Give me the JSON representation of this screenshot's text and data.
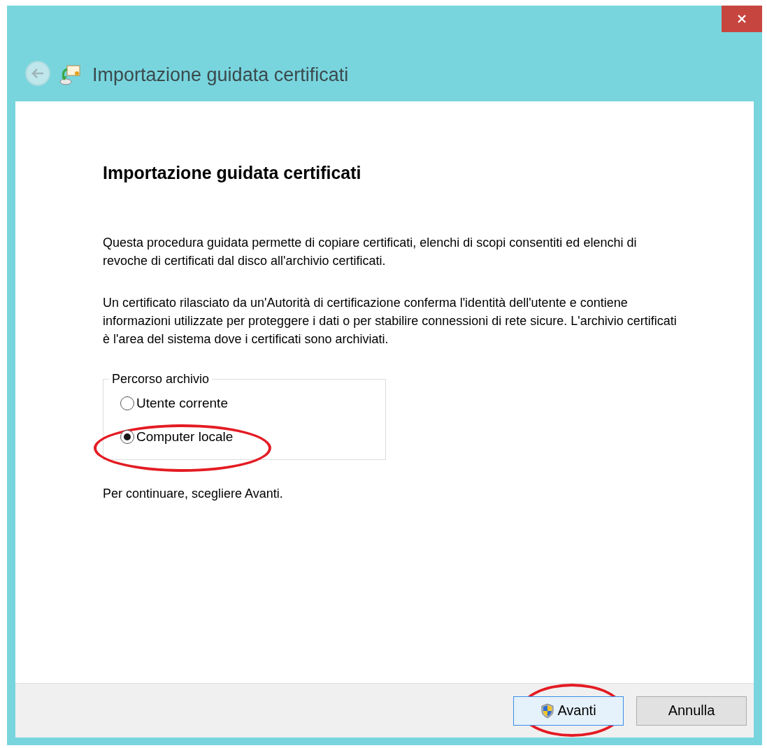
{
  "window": {
    "title": "Importazione guidata certificati"
  },
  "heading": "Importazione guidata certificati",
  "paragraphs": [
    "Questa procedura guidata permette di copiare certificati, elenchi di scopi consentiti ed elenchi di revoche di certificati dal disco all'archivio certificati.",
    "Un certificato rilasciato da un'Autorità di certificazione conferma l'identità dell'utente e contiene informazioni utilizzate per proteggere i dati o per stabilire connessioni di rete sicure. L'archivio certificati è l'area del sistema dove i certificati sono archiviati."
  ],
  "store_location": {
    "label": "Percorso archivio",
    "options": [
      {
        "label": "Utente corrente",
        "selected": false,
        "circled": false
      },
      {
        "label": "Computer locale",
        "selected": true,
        "circled": true
      }
    ]
  },
  "hint": "Per continuare, scegliere Avanti.",
  "buttons": [
    {
      "label": "Avanti",
      "kind": "shield",
      "focused": true,
      "circled": true
    },
    {
      "label": "Annulla",
      "kind": "plain",
      "focused": false,
      "circled": false
    }
  ]
}
